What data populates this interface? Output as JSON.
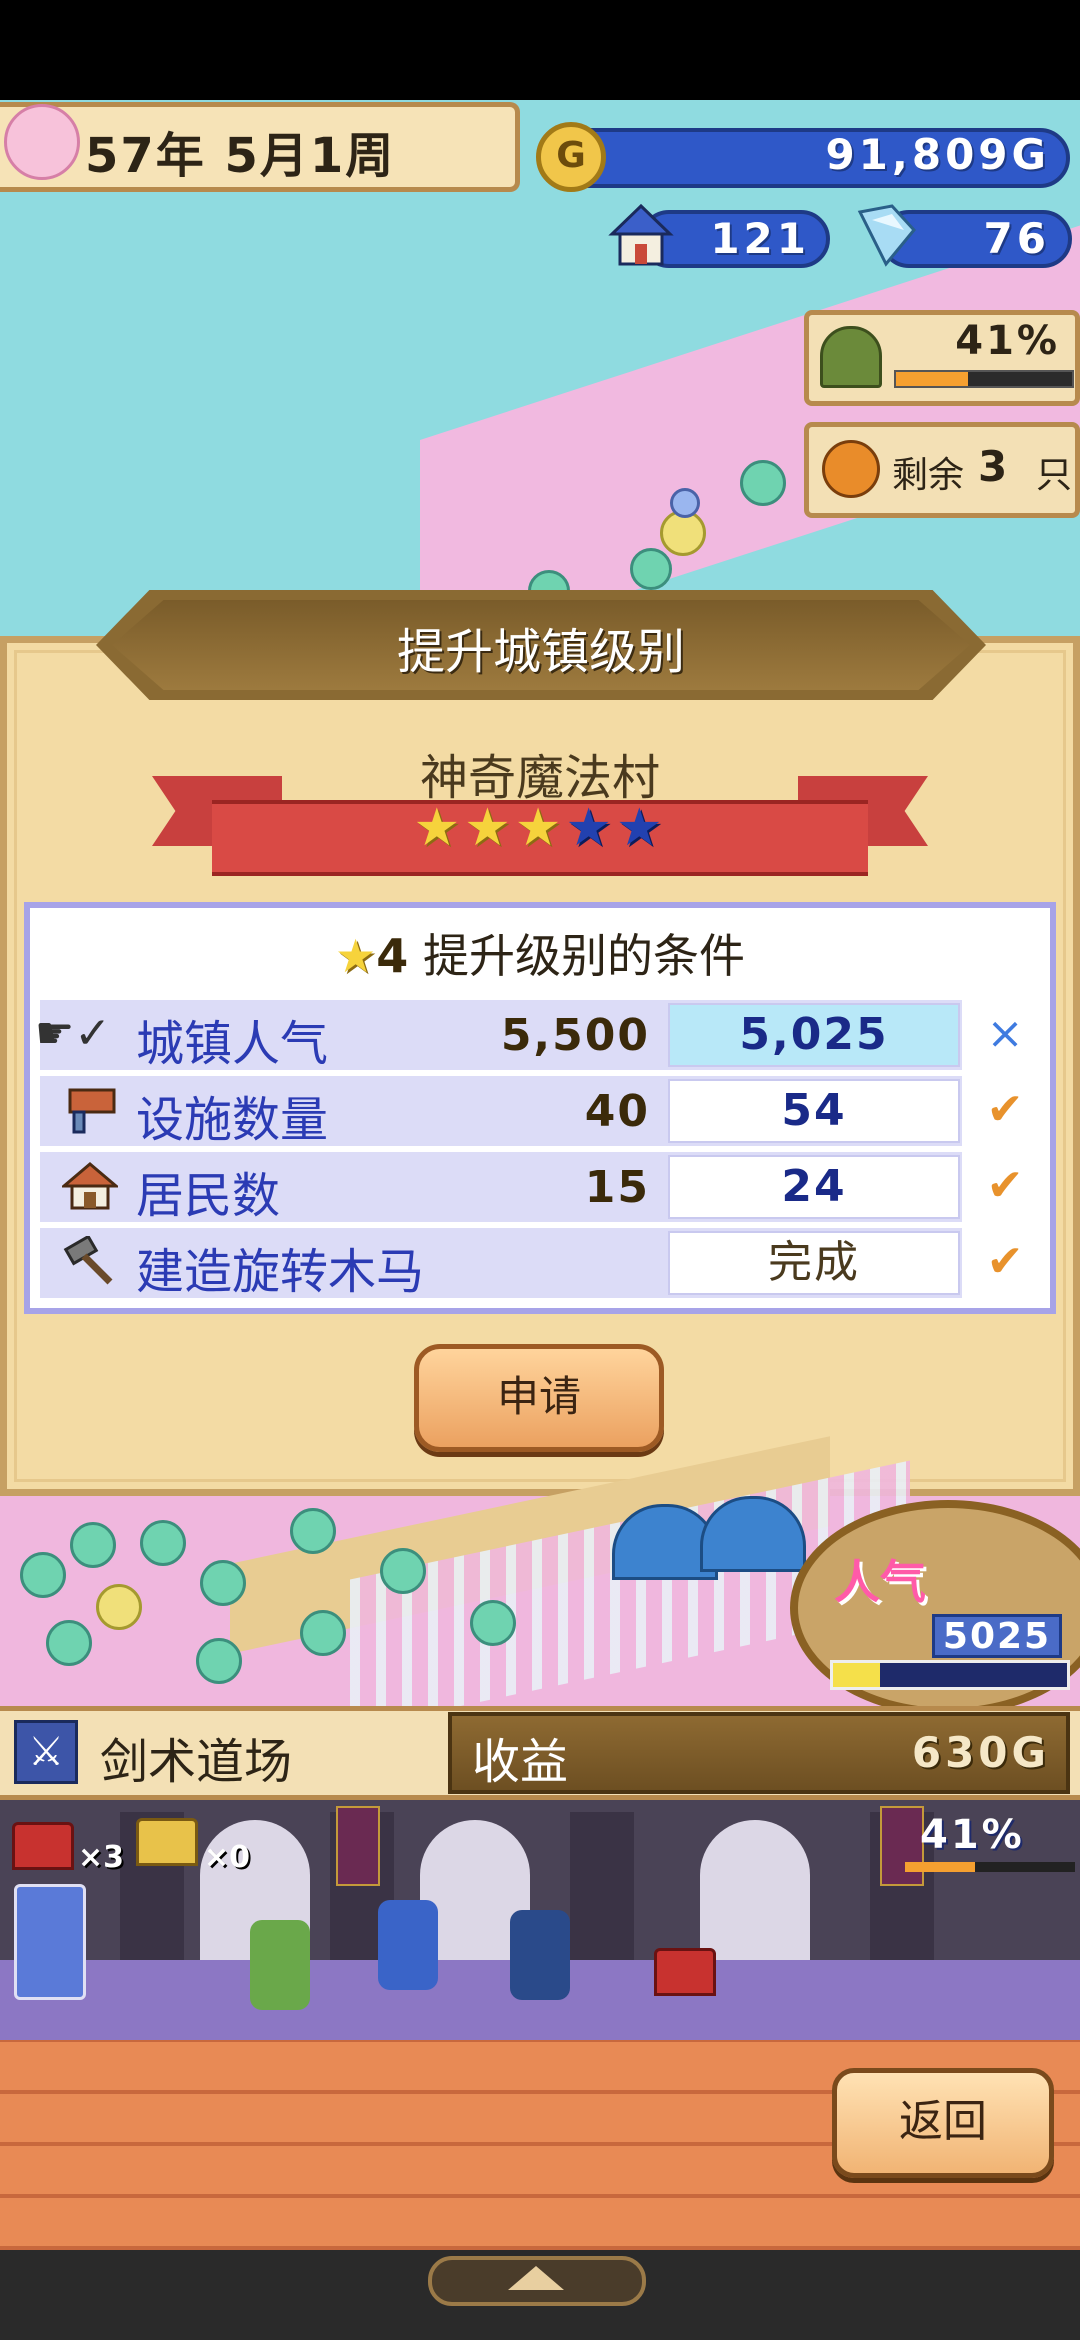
{
  "hud": {
    "date": "57年 5月1周",
    "gold": "91,809G",
    "houses": "121",
    "crystals": "76",
    "explore_percent": "41%",
    "explore_progress": 0.41,
    "remaining_label": "剩余",
    "remaining_count": "3",
    "remaining_unit": "只"
  },
  "modal": {
    "title": "提升城镇级别",
    "town_name": "神奇魔法村",
    "stars": {
      "filled": 3,
      "total": 5
    },
    "conditions_title": "提升级别的条件",
    "target_level": "4",
    "conditions": [
      {
        "label": "城镇人气",
        "required": "5,500",
        "current": "5,025",
        "status": "×",
        "icon": "pointing-hand-icon"
      },
      {
        "label": "设施数量",
        "required": "40",
        "current": "54",
        "status": "✔",
        "icon": "facility-icon"
      },
      {
        "label": "居民数",
        "required": "15",
        "current": "24",
        "status": "✔",
        "icon": "house-icon"
      },
      {
        "label": "建造旋转木马",
        "required": "",
        "current": "完成",
        "status": "✔",
        "icon": "hammer-icon"
      }
    ],
    "apply_label": "申请"
  },
  "popularity": {
    "label": "人气",
    "value": "5025",
    "progress": 0.2
  },
  "facility": {
    "name": "剑术道场",
    "income_label": "收益",
    "income_value": "630G"
  },
  "dungeon": {
    "progress_label": "41%",
    "progress": 0.41,
    "chest_red_count": "×3",
    "chest_gold_count": "×0"
  },
  "nav": {
    "back_label": "返回"
  },
  "colors": {
    "accent_blue": "#2f58c8",
    "panel": "#f3dba4",
    "popularity_pink": "#ff5ba8"
  }
}
